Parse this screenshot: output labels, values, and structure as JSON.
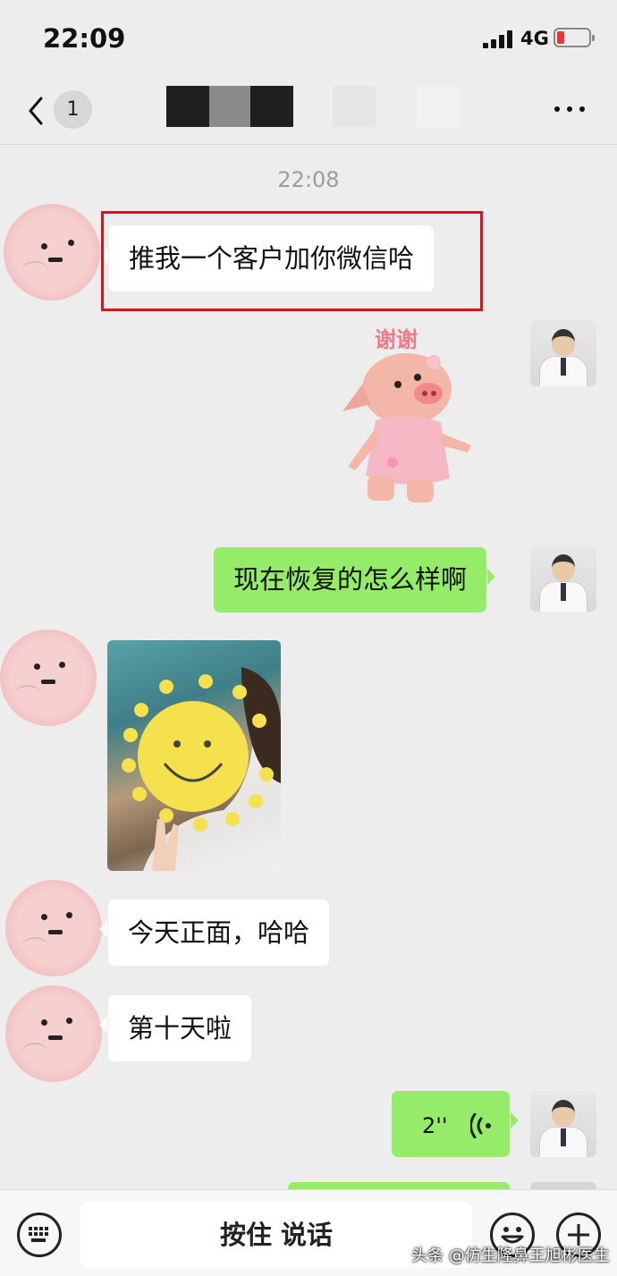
{
  "status_bar": {
    "time": "22:09",
    "network": "4G",
    "battery_level": 0.15,
    "battery_color": "#e53935"
  },
  "nav": {
    "back_icon": "chevron-left-icon",
    "unread_count": "1",
    "more_icon": "more-dots-icon"
  },
  "chat": {
    "timestamp": "22:08",
    "messages": [
      {
        "from": "contact",
        "type": "text",
        "text": "推我一个客户加你微信哈"
      },
      {
        "from": "me",
        "type": "sticker",
        "sticker_text": "谢谢"
      },
      {
        "from": "me",
        "type": "text",
        "text": "现在恢复的怎么样啊"
      },
      {
        "from": "contact",
        "type": "image"
      },
      {
        "from": "contact",
        "type": "text",
        "text": "今天正面，哈哈"
      },
      {
        "from": "contact",
        "type": "text",
        "text": "第十天啦"
      },
      {
        "from": "me",
        "type": "voice",
        "duration": "2''"
      }
    ]
  },
  "input_bar": {
    "keyboard_icon": "keyboard-icon",
    "hold_to_talk_label": "按住 说话",
    "emoji_icon": "emoji-icon",
    "plus_icon": "plus-icon"
  },
  "watermark": "头条 @仿生隆鼻王旭彬医生",
  "colors": {
    "background": "#ededed",
    "outgoing_bubble": "#95ec69",
    "incoming_bubble": "#ffffff",
    "highlight": "#e0101a"
  }
}
